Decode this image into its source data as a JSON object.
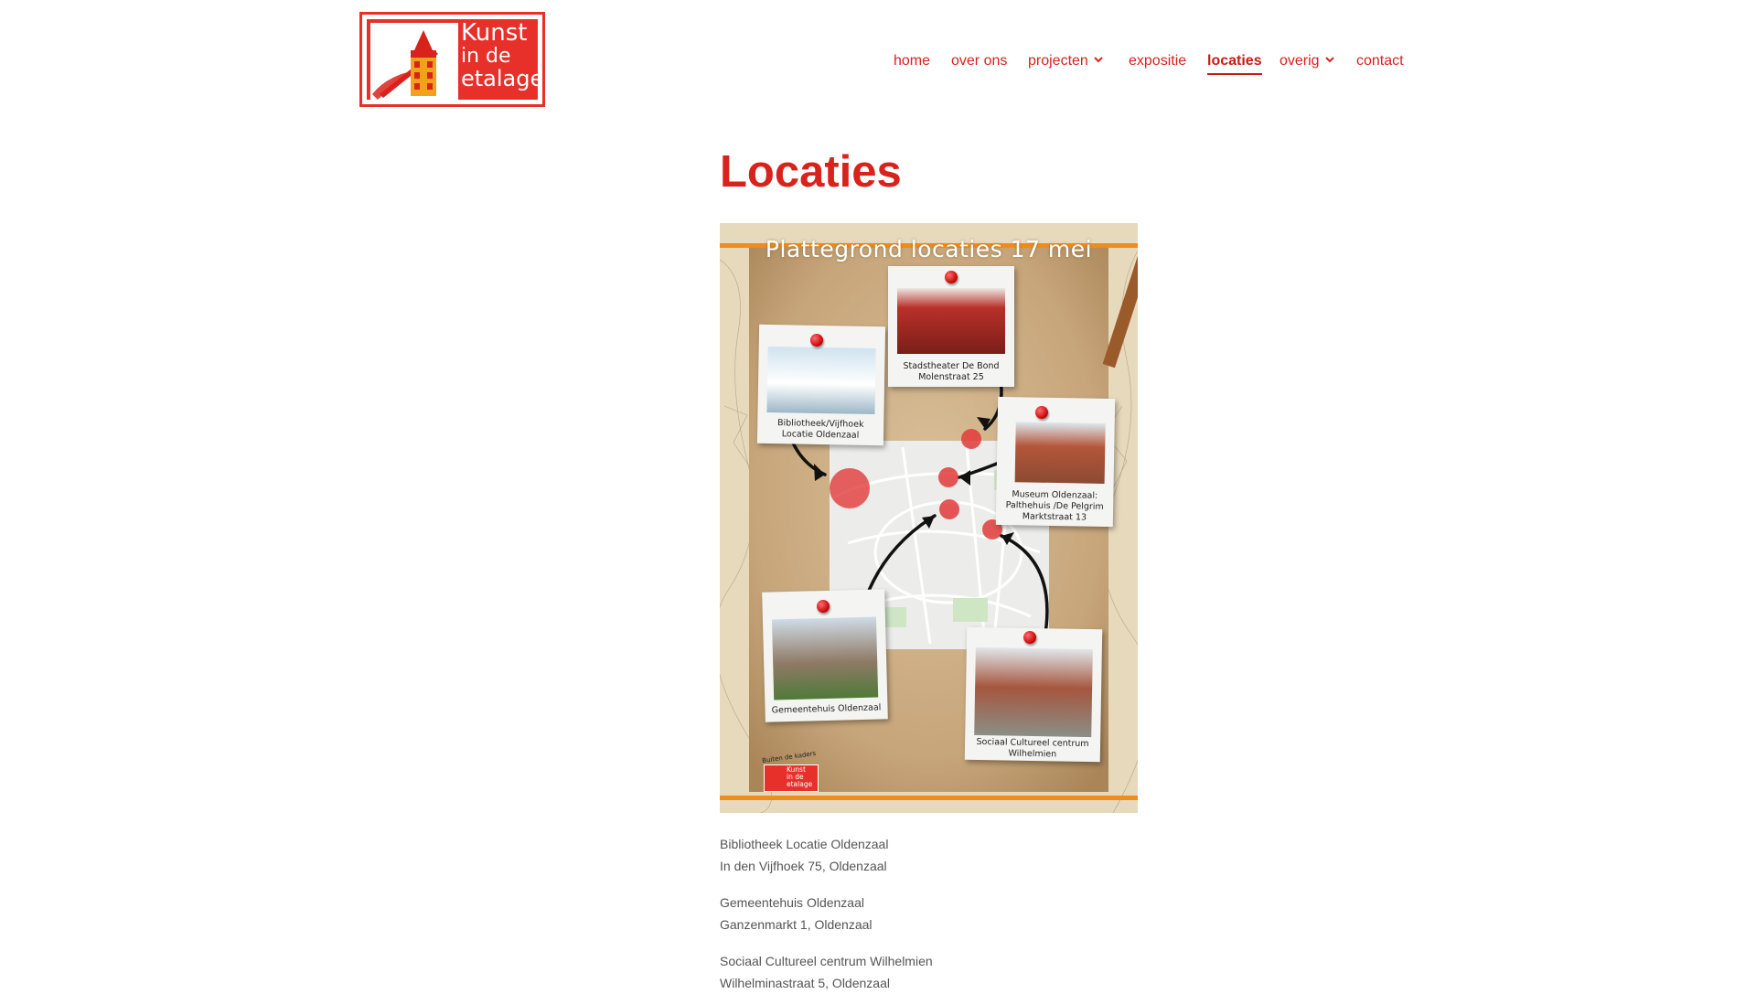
{
  "site": {
    "logo_lines": [
      "Kunst",
      "in de",
      "etalage"
    ]
  },
  "nav": {
    "items": [
      {
        "label": "home"
      },
      {
        "label": "over ons"
      },
      {
        "label": "projecten"
      },
      {
        "label": "expositie"
      },
      {
        "label": "locaties"
      },
      {
        "label": "overig"
      },
      {
        "label": "contact"
      }
    ],
    "active": "locaties"
  },
  "page": {
    "title": "Locaties"
  },
  "poster": {
    "title": "Plattegrond locaties 17 mei",
    "cards": [
      {
        "caption_line1": "Bibliotheek/Vijfhoek",
        "caption_line2": "Locatie Oldenzaal",
        "caption_line3": ""
      },
      {
        "caption_line1": "Stadstheater De Bond",
        "caption_line2": "Molenstraat 25",
        "caption_line3": ""
      },
      {
        "caption_line1": "Museum Oldenzaal:",
        "caption_line2": "Palthehuis /De Pelgrim",
        "caption_line3": "Marktstraat 13"
      },
      {
        "caption_line1": "Gemeentehuis Oldenzaal",
        "caption_line2": "",
        "caption_line3": ""
      },
      {
        "caption_line1": "Sociaal Cultureel centrum",
        "caption_line2": "Wilhelmien",
        "caption_line3": ""
      }
    ],
    "mini_logo_tag": "Buiten de kaders",
    "mini_logo_lines": [
      "Kunst",
      "in de",
      "etalage"
    ]
  },
  "addresses": [
    {
      "name": "Bibliotheek Locatie Oldenzaal",
      "street": "In den Vijfhoek 75, Oldenzaal"
    },
    {
      "name": "Gemeentehuis Oldenzaal",
      "street": "Ganzenmarkt 1, Oldenzaal"
    },
    {
      "name": "Sociaal Cultureel centrum Wilhelmien",
      "street": "Wilhelminastraat 5, Oldenzaal"
    }
  ],
  "colors": {
    "brand_red": "#d9221c",
    "logo_red": "#e8302b",
    "body_text": "#555555"
  }
}
